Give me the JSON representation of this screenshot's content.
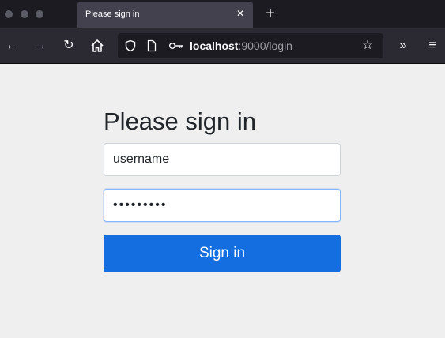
{
  "browser": {
    "tab": {
      "title": "Please sign in",
      "close": "✕"
    },
    "new_tab": "+",
    "url": {
      "host": "localhost",
      "rest": ":9000/login"
    },
    "nav": {
      "back": "←",
      "forward": "→",
      "reload": "↻",
      "home": "⌂",
      "star": "☆",
      "overflow": "»",
      "menu": "≡"
    }
  },
  "login": {
    "heading": "Please sign in",
    "username_value": "username",
    "password_value": "•••••••••",
    "submit_label": "Sign in"
  },
  "colors": {
    "accent": "#146ee0",
    "page_background": "#efefef",
    "chrome_dark": "#1c1b22",
    "toolbar": "#2b2a33"
  }
}
